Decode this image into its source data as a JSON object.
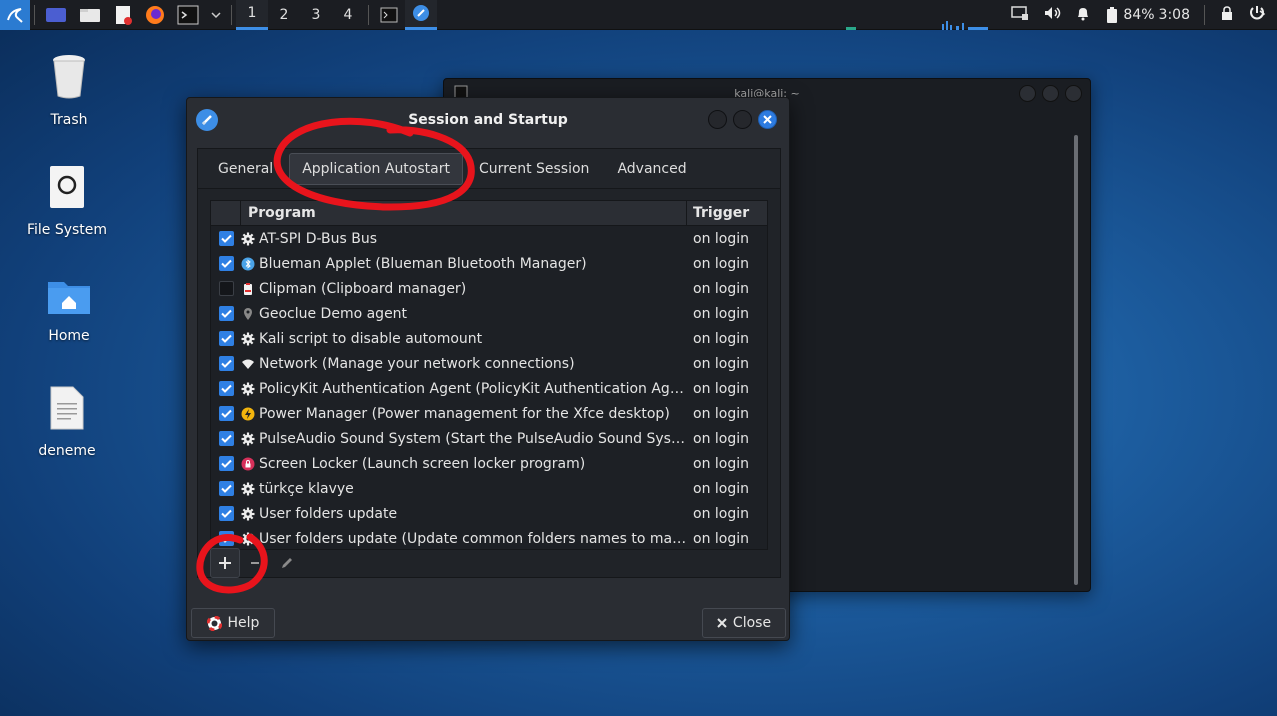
{
  "panel": {
    "workspaces": [
      "1",
      "2",
      "3",
      "4"
    ],
    "battery": "84%",
    "time": "3:08"
  },
  "desktop": {
    "icons": [
      {
        "label": "Trash"
      },
      {
        "label": "File System"
      },
      {
        "label": "Home"
      },
      {
        "label": "deneme"
      }
    ]
  },
  "terminal": {
    "title": "kali@kali: ~"
  },
  "dialog": {
    "title": "Session and Startup",
    "tabs": [
      "General",
      "Application Autostart",
      "Current Session",
      "Advanced"
    ],
    "active_tab": "Application Autostart",
    "columns": {
      "program": "Program",
      "trigger": "Trigger"
    },
    "rows": [
      {
        "checked": true,
        "icon": "gear-icon",
        "program": "AT-SPI D-Bus Bus",
        "trigger": "on login"
      },
      {
        "checked": true,
        "icon": "bluetooth-icon",
        "program": "Blueman Applet (Blueman Bluetooth Manager)",
        "trigger": "on login"
      },
      {
        "checked": false,
        "icon": "clipboard-icon",
        "program": "Clipman (Clipboard manager)",
        "trigger": "on login"
      },
      {
        "checked": true,
        "icon": "location-icon",
        "program": "Geoclue Demo agent",
        "trigger": "on login"
      },
      {
        "checked": true,
        "icon": "gear-icon",
        "program": "Kali script to disable automount",
        "trigger": "on login"
      },
      {
        "checked": true,
        "icon": "wifi-icon",
        "program": "Network (Manage your network connections)",
        "trigger": "on login"
      },
      {
        "checked": true,
        "icon": "gear-icon",
        "program": "PolicyKit Authentication Agent (PolicyKit Authentication Agent)",
        "trigger": "on login"
      },
      {
        "checked": true,
        "icon": "power-icon",
        "program": "Power Manager (Power management for the Xfce desktop)",
        "trigger": "on login"
      },
      {
        "checked": true,
        "icon": "gear-icon",
        "program": "PulseAudio Sound System (Start the PulseAudio Sound System)",
        "trigger": "on login"
      },
      {
        "checked": true,
        "icon": "lock-icon",
        "program": "Screen Locker (Launch screen locker program)",
        "trigger": "on login"
      },
      {
        "checked": true,
        "icon": "gear-icon",
        "program": "türkçe klavye",
        "trigger": "on login"
      },
      {
        "checked": true,
        "icon": "gear-icon",
        "program": "User folders update",
        "trigger": "on login"
      },
      {
        "checked": true,
        "icon": "gear-icon",
        "program": "User folders update (Update common folders names to match c...",
        "trigger": "on login"
      }
    ],
    "toolbar": {
      "add": "+",
      "remove": "−"
    },
    "help_label": "Help",
    "close_label": "Close"
  },
  "colors": {
    "accent": "#2f80e4",
    "annotation": "#e8141c"
  }
}
